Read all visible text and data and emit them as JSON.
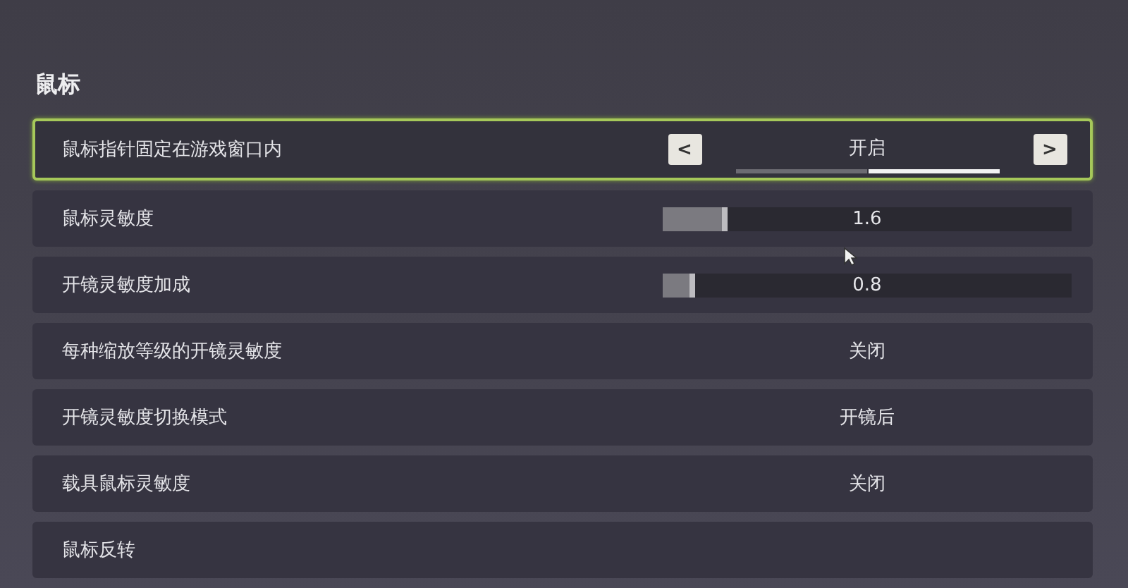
{
  "section_title": "鼠标",
  "settings": [
    {
      "kind": "picker",
      "label": "鼠标指针固定在游戏窗口内",
      "focused": true,
      "value": "开启",
      "prev": "<",
      "next": ">",
      "options": [
        {
          "selected": false
        },
        {
          "selected": true
        }
      ]
    },
    {
      "kind": "slider",
      "label": "鼠标灵敏度",
      "focused": false,
      "value": "1.6",
      "level": 0.16
    },
    {
      "kind": "slider",
      "label": "开镜灵敏度加成",
      "focused": false,
      "value": "0.8",
      "level": 0.08
    },
    {
      "kind": "value",
      "label": "每种缩放等级的开镜灵敏度",
      "focused": false,
      "value": "关闭"
    },
    {
      "kind": "value",
      "label": "开镜灵敏度切换模式",
      "focused": false,
      "value": "开镜后"
    },
    {
      "kind": "value",
      "label": "载具鼠标灵敏度",
      "focused": false,
      "value": "关闭"
    },
    {
      "kind": "value",
      "label": "鼠标反转",
      "focused": false
    }
  ]
}
